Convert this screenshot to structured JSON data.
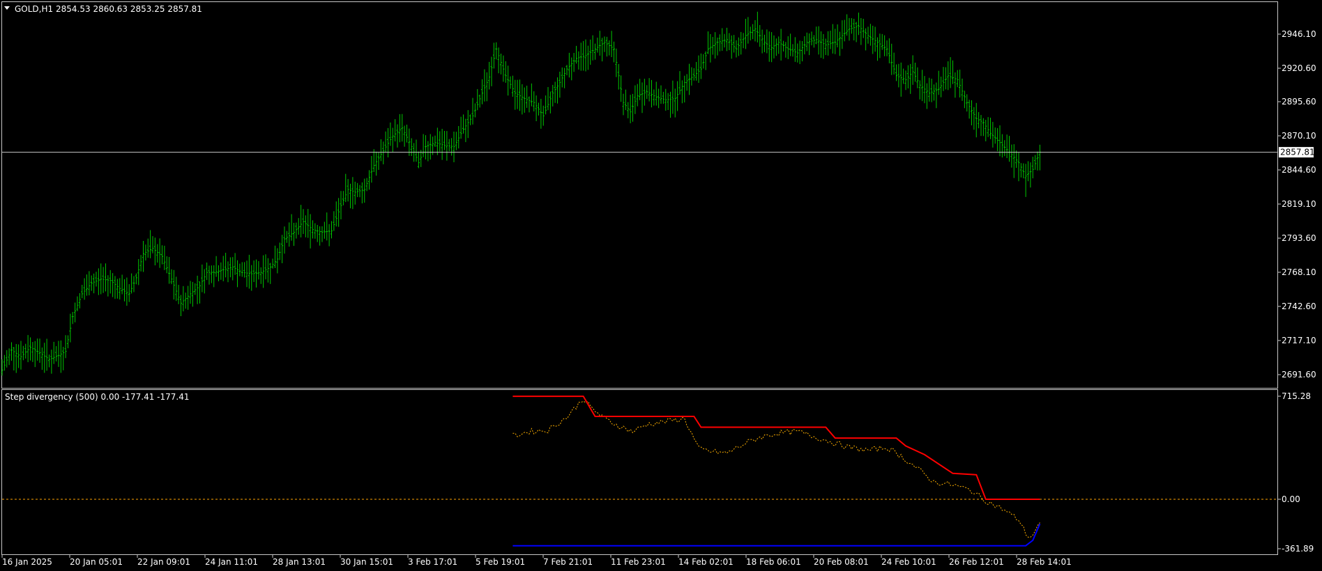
{
  "symbol_header": {
    "symbol": "GOLD,H1",
    "ohlc": "2854.53 2860.63 2853.25 2857.81"
  },
  "indicator_header": "Step divergency (500) 0.00 -177.41 -177.41",
  "colors": {
    "background": "#000000",
    "bars": "#00c800",
    "grid": "#c8c8c8",
    "price_line": "#c8c8c8",
    "price_tag_bg": "#ffffff",
    "upper_step": "#ff0000",
    "lower_step": "#0000ff",
    "divergence": "#ffb000",
    "zero_line": "#ffa500"
  },
  "chart_data": [
    {
      "type": "line",
      "series_label": "GOLD,H1",
      "y_ticks": [
        "2946.10",
        "2920.60",
        "2895.60",
        "2870.10",
        "2844.60",
        "2819.10",
        "2793.60",
        "2768.10",
        "2742.60",
        "2717.10",
        "2691.60"
      ],
      "current_price": "2857.81",
      "ylim": [
        2684,
        2965
      ],
      "x_ticks": [
        "16 Jan 2025",
        "20 Jan 05:01",
        "22 Jan 09:01",
        "24 Jan 11:01",
        "28 Jan 13:01",
        "30 Jan 15:01",
        "3 Feb 17:01",
        "5 Feb 19:01",
        "7 Feb 21:01",
        "11 Feb 23:01",
        "14 Feb 02:01",
        "18 Feb 06:01",
        "20 Feb 08:01",
        "24 Feb 10:01",
        "26 Feb 12:01",
        "28 Feb 14:01"
      ],
      "close_path": [
        [
          0,
          2695
        ],
        [
          2,
          2710
        ],
        [
          4,
          2705
        ],
        [
          6,
          2712
        ],
        [
          8,
          2708
        ],
        [
          10,
          2703
        ],
        [
          12,
          2706
        ],
        [
          13.5,
          2709
        ],
        [
          15,
          2735
        ],
        [
          17,
          2752
        ],
        [
          19,
          2760
        ],
        [
          21,
          2763
        ],
        [
          23,
          2762
        ],
        [
          25,
          2756
        ],
        [
          27,
          2752
        ],
        [
          28.5,
          2764
        ],
        [
          30,
          2782
        ],
        [
          32,
          2786
        ],
        [
          34,
          2780
        ],
        [
          36,
          2763
        ],
        [
          38,
          2745
        ],
        [
          40,
          2752
        ],
        [
          42,
          2758
        ],
        [
          43.5,
          2768
        ],
        [
          45,
          2768
        ],
        [
          47,
          2770
        ],
        [
          49,
          2772
        ],
        [
          51,
          2768
        ],
        [
          53,
          2767
        ],
        [
          55,
          2768
        ],
        [
          57,
          2772
        ],
        [
          58.5,
          2778
        ],
        [
          60,
          2793
        ],
        [
          62,
          2798
        ],
        [
          64,
          2806
        ],
        [
          66,
          2800
        ],
        [
          68,
          2798
        ],
        [
          70,
          2799
        ],
        [
          72,
          2818
        ],
        [
          73.5,
          2830
        ],
        [
          75,
          2828
        ],
        [
          77,
          2830
        ],
        [
          79,
          2848
        ],
        [
          81,
          2859
        ],
        [
          83,
          2870
        ],
        [
          85,
          2876
        ],
        [
          87,
          2862
        ],
        [
          88.5,
          2850
        ],
        [
          90,
          2862
        ],
        [
          92,
          2865
        ],
        [
          94,
          2863
        ],
        [
          96,
          2862
        ],
        [
          98,
          2875
        ],
        [
          100,
          2885
        ],
        [
          102,
          2902
        ],
        [
          103.5,
          2914
        ],
        [
          105,
          2935
        ],
        [
          107,
          2915
        ],
        [
          109,
          2902
        ],
        [
          111,
          2898
        ],
        [
          113,
          2895
        ],
        [
          115,
          2885
        ],
        [
          117,
          2902
        ],
        [
          118.5,
          2910
        ],
        [
          120,
          2920
        ],
        [
          122,
          2928
        ],
        [
          124,
          2930
        ],
        [
          126,
          2935
        ],
        [
          128,
          2940
        ],
        [
          130,
          2935
        ],
        [
          132,
          2895
        ],
        [
          133.5,
          2888
        ],
        [
          135,
          2900
        ],
        [
          137,
          2903
        ],
        [
          139,
          2899
        ],
        [
          141,
          2897
        ],
        [
          143,
          2898
        ],
        [
          145,
          2910
        ],
        [
          147,
          2915
        ],
        [
          148.5,
          2920
        ],
        [
          150,
          2935
        ],
        [
          152,
          2940
        ],
        [
          154,
          2942
        ],
        [
          156,
          2935
        ],
        [
          158,
          2945
        ],
        [
          160,
          2950
        ],
        [
          162,
          2940
        ],
        [
          163.5,
          2936
        ],
        [
          165,
          2940
        ],
        [
          167,
          2935
        ],
        [
          169,
          2932
        ],
        [
          171,
          2940
        ],
        [
          173,
          2942
        ],
        [
          175,
          2938
        ],
        [
          177,
          2940
        ],
        [
          178.5,
          2945
        ],
        [
          180,
          2950
        ],
        [
          182,
          2952
        ],
        [
          184,
          2945
        ],
        [
          186,
          2940
        ],
        [
          188,
          2935
        ],
        [
          190,
          2915
        ],
        [
          192,
          2912
        ],
        [
          193.5,
          2918
        ],
        [
          195,
          2908
        ],
        [
          197,
          2902
        ],
        [
          199,
          2905
        ],
        [
          201,
          2915
        ],
        [
          203,
          2912
        ],
        [
          205,
          2895
        ],
        [
          207,
          2883
        ],
        [
          208.5,
          2880
        ],
        [
          210,
          2872
        ],
        [
          212,
          2865
        ],
        [
          214,
          2858
        ],
        [
          216,
          2850
        ],
        [
          217.5,
          2840
        ],
        [
          219,
          2845
        ],
        [
          220.5,
          2858
        ]
      ]
    },
    {
      "type": "line",
      "series_label": "Step divergency (500)",
      "y_ticks": [
        "715.28",
        "0.00",
        "-361.89"
      ],
      "ylim": [
        -361.89,
        715.28
      ],
      "x_range": [
        108.5,
        220.5
      ],
      "upper_step": [
        [
          108.5,
          715
        ],
        [
          123.5,
          715
        ],
        [
          126,
          575
        ],
        [
          147,
          575
        ],
        [
          148.5,
          500
        ],
        [
          175,
          500
        ],
        [
          177,
          425
        ],
        [
          190,
          425
        ],
        [
          192,
          370
        ],
        [
          196,
          310
        ],
        [
          202,
          180
        ],
        [
          207,
          170
        ],
        [
          209,
          0
        ],
        [
          220.5,
          0
        ]
      ],
      "lower_step": [
        [
          108.5,
          -340
        ],
        [
          217.5,
          -340
        ],
        [
          219,
          -300
        ],
        [
          220.5,
          -180
        ]
      ],
      "divergence": [
        [
          108.5,
          440
        ],
        [
          112,
          470
        ],
        [
          116,
          480
        ],
        [
          120,
          570
        ],
        [
          123.5,
          700
        ],
        [
          125,
          640
        ],
        [
          128,
          560
        ],
        [
          131,
          510
        ],
        [
          134,
          470
        ],
        [
          137,
          520
        ],
        [
          141,
          540
        ],
        [
          145,
          560
        ],
        [
          148,
          350
        ],
        [
          151,
          330
        ],
        [
          154,
          320
        ],
        [
          158,
          390
        ],
        [
          161,
          430
        ],
        [
          165,
          460
        ],
        [
          169,
          470
        ],
        [
          173,
          430
        ],
        [
          177,
          390
        ],
        [
          180,
          360
        ],
        [
          184,
          340
        ],
        [
          188,
          360
        ],
        [
          191,
          300
        ],
        [
          195,
          200
        ],
        [
          198,
          120
        ],
        [
          202,
          100
        ],
        [
          206,
          60
        ],
        [
          209,
          -10
        ],
        [
          213,
          -80
        ],
        [
          216,
          -150
        ],
        [
          218,
          -277
        ],
        [
          219,
          -260
        ],
        [
          220.5,
          -177
        ]
      ],
      "zero_line": "0.00"
    }
  ]
}
